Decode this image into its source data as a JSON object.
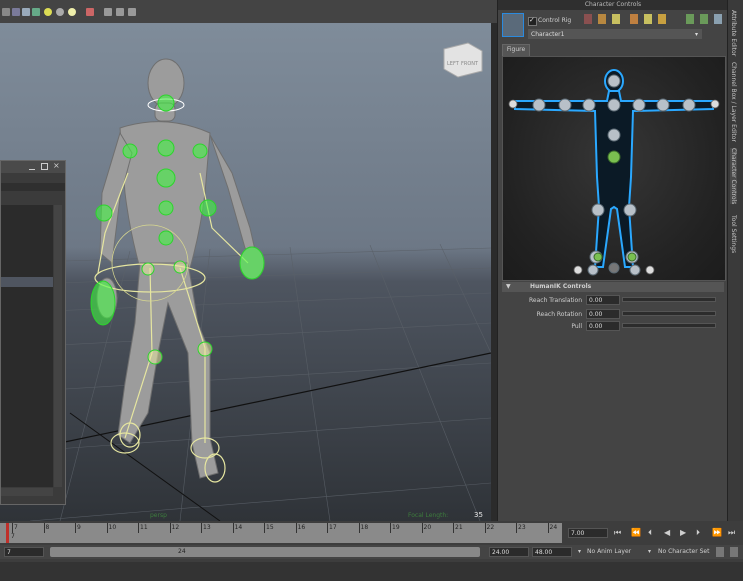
{
  "panel": {
    "title": "Character Controls",
    "control_rig_label": "Control Rig",
    "control_rig_checked": true,
    "character_name": "Character1",
    "figure_tab": "Figure"
  },
  "humanik": {
    "section_title": "HumanIK Controls",
    "reach_translation_label": "Reach Translation",
    "reach_translation_value": "0.00",
    "reach_rotation_label": "Reach Rotation",
    "reach_rotation_value": "0.00",
    "pull_label": "Pull",
    "pull_value": "0.00"
  },
  "side_tabs": [
    "Attribute Editor",
    "Channel Box / Layer Editor",
    "Character Controls",
    "Tool Settings"
  ],
  "viewport": {
    "view_cube_left": "LEFT",
    "view_cube_front": "FRONT",
    "frame_counter": "35",
    "hud_left": "persp",
    "hud_right": "Focal Length:"
  },
  "timeline": {
    "ticks": [
      "7",
      "8",
      "9",
      "10",
      "11",
      "12",
      "13",
      "14",
      "15",
      "16",
      "17",
      "18",
      "19",
      "20",
      "21",
      "22",
      "23",
      "24"
    ],
    "current_frame_marker": "7",
    "current_frame": "7.00",
    "range_start": "7",
    "range_handle": "24",
    "range_end": "24.00",
    "anim_end": "48.00",
    "anim_layer": "No Anim Layer",
    "character_set": "No Character Set"
  },
  "colors": {
    "accent_green": "#3cff3c",
    "rig_yellow": "#e8e8a0",
    "figure_blue": "#2aa8ff"
  }
}
